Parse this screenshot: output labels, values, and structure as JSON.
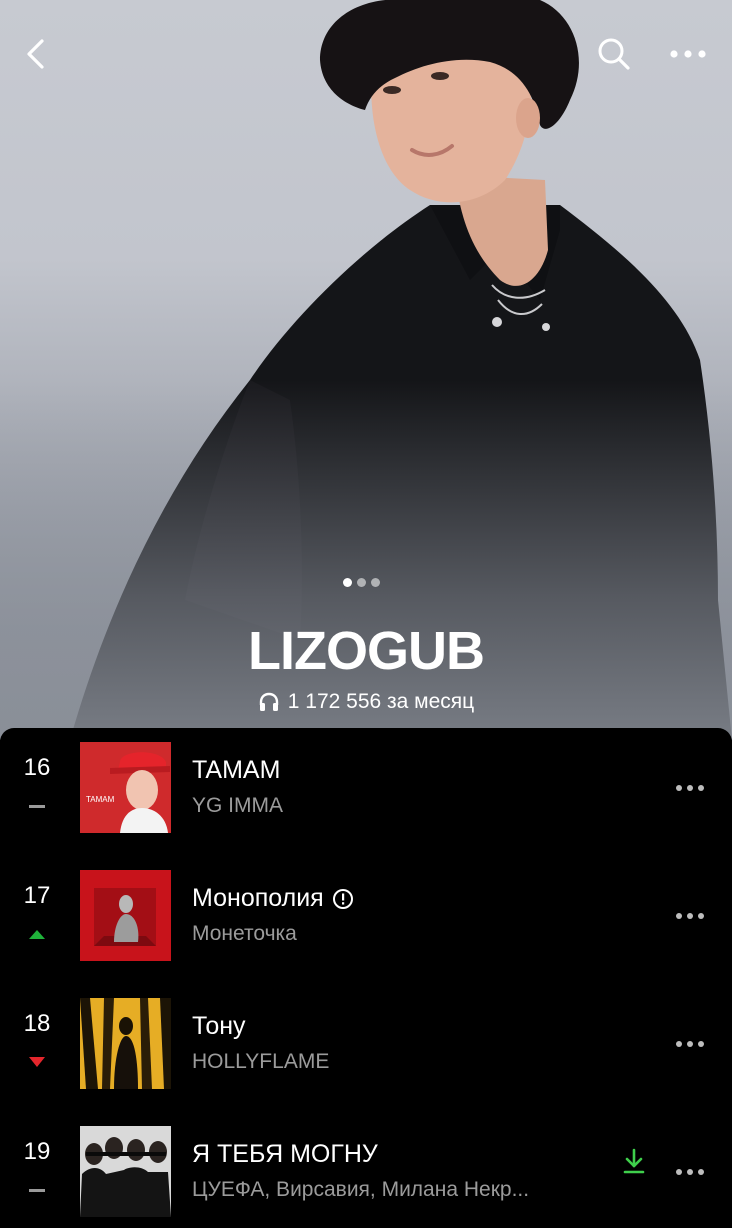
{
  "artist": {
    "name": "LIZOGUB",
    "listeners": "1 172 556 за месяц"
  },
  "gallery": {
    "slides": 3,
    "active": 0
  },
  "tracks": [
    {
      "rank": "16",
      "trend": "same",
      "title": "TAMAM",
      "artist": "YG IMMA",
      "explicit": false,
      "downloaded": false,
      "cover_text": "TAMAM"
    },
    {
      "rank": "17",
      "trend": "up",
      "title": "Монополия",
      "artist": "Монеточка",
      "explicit": true,
      "downloaded": false
    },
    {
      "rank": "18",
      "trend": "down",
      "title": "Тону",
      "artist": "HOLLYFLAME",
      "explicit": false,
      "downloaded": false
    },
    {
      "rank": "19",
      "trend": "same",
      "title": "Я ТЕБЯ МОГНУ",
      "artist": "ЦУЕФА, Вирсавия, Милана Некр...",
      "explicit": false,
      "downloaded": true
    }
  ],
  "icons": {
    "back": "chevron-left-icon",
    "search": "search-icon",
    "more": "more-horizontal-icon",
    "listeners": "headphones-icon",
    "explicit": "explicit-icon",
    "download": "download-icon",
    "trend_up": "triangle-up-icon",
    "trend_down": "triangle-down-icon",
    "trend_same": "dash-icon"
  },
  "colors": {
    "trend_up": "#1fb23a",
    "trend_down": "#e4262c",
    "download": "#3fcf4c",
    "secondary_text": "#9b9b9b"
  }
}
